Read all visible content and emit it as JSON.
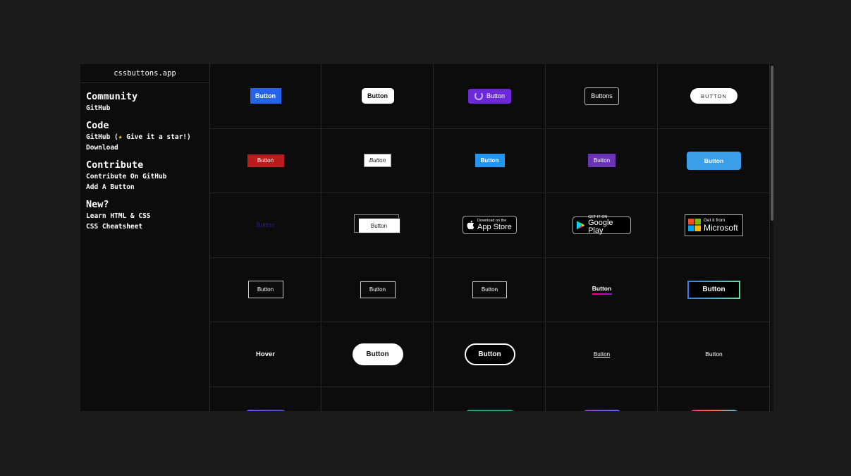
{
  "sidebar": {
    "brand": "cssbuttons.app",
    "sections": {
      "community": {
        "title": "Community",
        "links": [
          "GitHub"
        ]
      },
      "code": {
        "title": "Code",
        "github_prefix": "GitHub (",
        "star": "★",
        "github_suffix": " Give it a star!)",
        "download": "Download"
      },
      "contribute": {
        "title": "Contribute",
        "links": [
          "Contribute On GitHub",
          "Add A Button"
        ]
      },
      "new": {
        "title": "New?",
        "links": [
          "Learn HTML & CSS",
          "CSS Cheatsheet"
        ]
      }
    }
  },
  "buttons": {
    "r1": [
      "Button",
      "Button",
      "Button",
      "Buttons",
      "BUTTON"
    ],
    "r2": [
      "Button",
      "Button",
      "Button",
      "Button",
      "Button"
    ],
    "r3": {
      "plain": "Button",
      "offset": "Button",
      "appstore_small": "Download on the",
      "appstore_big": "App Store",
      "play_small": "GET IT ON",
      "play_big": "Google Play",
      "ms_small": "Get it from",
      "ms_big": "Microsoft"
    },
    "r4": [
      "Button",
      "Button",
      "Button",
      "Button",
      "Button"
    ],
    "r5": [
      "Hover",
      "Button",
      "Button",
      "Button",
      "Button"
    ]
  },
  "colors": {
    "background": "#1b1b1b",
    "panel": "#0c0c0c",
    "accent_blue": "#2563eb",
    "accent_purple": "#6d28d9",
    "accent_red": "#b91c1c",
    "star": "#f6d13a"
  }
}
